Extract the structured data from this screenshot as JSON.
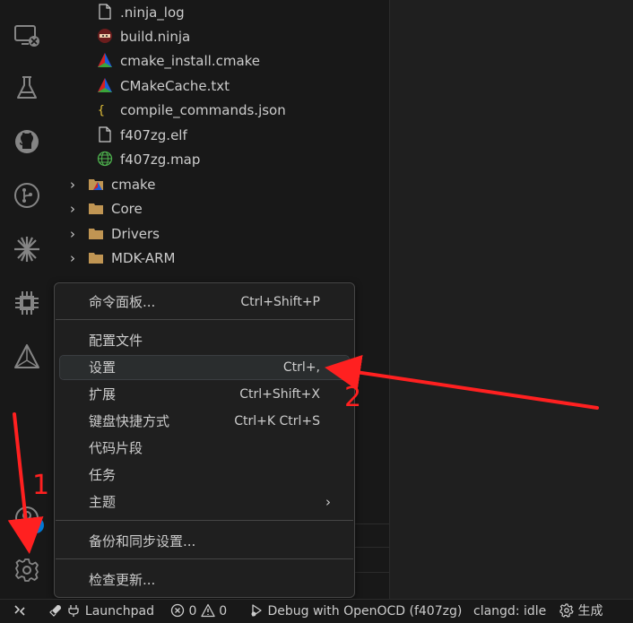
{
  "activity_bar": {
    "icons": [
      "remote-explorer-icon",
      "testing-icon",
      "github-icon",
      "source-control-icon",
      "sparkle-icon",
      "chip-icon",
      "cmake-icon",
      "account-icon",
      "settings-gear-icon"
    ],
    "badge_count": "1"
  },
  "explorer": {
    "files": [
      {
        "name": ".ninja_log",
        "icon": "file-icon"
      },
      {
        "name": "build.ninja",
        "icon": "ninja-icon"
      },
      {
        "name": "cmake_install.cmake",
        "icon": "cmake-icon"
      },
      {
        "name": "CMakeCache.txt",
        "icon": "cmake-icon"
      },
      {
        "name": "compile_commands.json",
        "icon": "json-icon"
      },
      {
        "name": "f407zg.elf",
        "icon": "file-icon"
      },
      {
        "name": "f407zg.map",
        "icon": "globe-icon"
      }
    ],
    "folders": [
      {
        "name": "cmake",
        "icon": "cmake-folder-icon"
      },
      {
        "name": "Core",
        "icon": "folder-icon"
      },
      {
        "name": "Drivers",
        "icon": "folder-icon"
      },
      {
        "name": "MDK-ARM",
        "icon": "folder-icon"
      }
    ]
  },
  "menu": {
    "items": [
      {
        "label": "命令面板...",
        "shortcut": "Ctrl+Shift+P"
      },
      {
        "label": "配置文件",
        "shortcut": ""
      },
      {
        "label": "设置",
        "shortcut": "Ctrl+,"
      },
      {
        "label": "扩展",
        "shortcut": "Ctrl+Shift+X"
      },
      {
        "label": "键盘快捷方式",
        "shortcut": "Ctrl+K Ctrl+S"
      },
      {
        "label": "代码片段",
        "shortcut": ""
      },
      {
        "label": "任务",
        "shortcut": ""
      },
      {
        "label": "主题",
        "shortcut": "",
        "submenu": "›"
      },
      {
        "label": "备份和同步设置...",
        "shortcut": ""
      },
      {
        "label": "检查更新...",
        "shortcut": ""
      }
    ]
  },
  "status_bar": {
    "launchpad": "Launchpad",
    "errors": "0",
    "warnings": "0",
    "debug": "Debug with OpenOCD (f407zg)",
    "clangd": "clangd: idle",
    "build": "生成"
  },
  "annotations": {
    "label_1": "1",
    "label_2": "2",
    "color": "#ff2020"
  },
  "colors": {
    "accent": "#0078d4",
    "background": "#181818",
    "menu_background": "#1f1f1f"
  }
}
